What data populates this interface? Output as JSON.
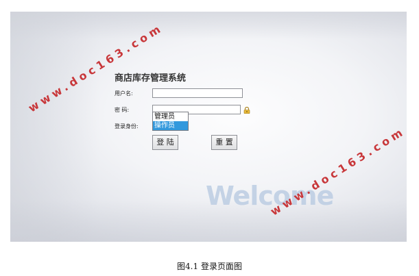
{
  "login": {
    "system_title": "商店库存管理系统",
    "username_label": "用户名:",
    "password_label": "密 码:",
    "identity_label": "登录身份:",
    "role_options": [
      "管理员",
      "操作员"
    ],
    "selected_role": "操作员",
    "login_button": "登 陆",
    "reset_button": "重 置",
    "welcome_text": "Welcome"
  },
  "watermark": "www.doc163.com",
  "caption": "图4.1 登录页面图",
  "colors": {
    "watermark": "#c8373a",
    "selection": "#3399dd"
  }
}
